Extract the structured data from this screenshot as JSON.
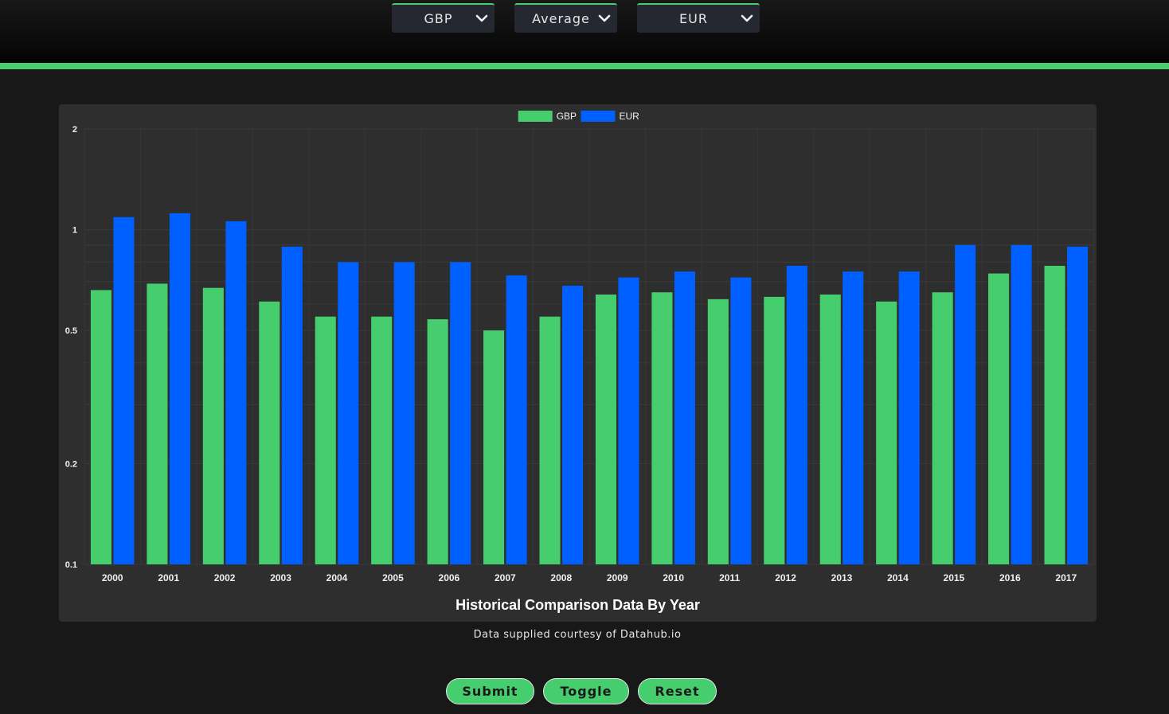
{
  "controls": {
    "base_currency": "GBP",
    "statistic": "Average",
    "target_currency": "EUR"
  },
  "colors": {
    "accent": "#46cd6e",
    "series_gbp": "#46cd6e",
    "series_eur": "#0060ff"
  },
  "icons": {
    "dropdown": "chevron-down-icon"
  },
  "chart_data": {
    "type": "bar",
    "title": "Historical Comparison Data By Year",
    "xlabel": "",
    "ylabel": "",
    "yscale": "log",
    "ylim": [
      0.1,
      2
    ],
    "yticks": [
      2,
      1,
      0.5,
      0.2,
      0.1
    ],
    "ytick_labels": [
      "2",
      "1",
      "0.5",
      "0.2",
      "0.1"
    ],
    "grid": true,
    "legend": "top-center",
    "categories": [
      "2000",
      "2001",
      "2002",
      "2003",
      "2004",
      "2005",
      "2006",
      "2007",
      "2008",
      "2009",
      "2010",
      "2011",
      "2012",
      "2013",
      "2014",
      "2015",
      "2016",
      "2017"
    ],
    "series": [
      {
        "name": "GBP",
        "color": "#46cd6e",
        "values": [
          0.66,
          0.69,
          0.67,
          0.61,
          0.55,
          0.55,
          0.54,
          0.5,
          0.55,
          0.64,
          0.65,
          0.62,
          0.63,
          0.64,
          0.61,
          0.65,
          0.74,
          0.78
        ]
      },
      {
        "name": "EUR",
        "color": "#0060ff",
        "values": [
          1.09,
          1.12,
          1.06,
          0.89,
          0.8,
          0.8,
          0.8,
          0.73,
          0.68,
          0.72,
          0.75,
          0.72,
          0.78,
          0.75,
          0.75,
          0.9,
          0.9,
          0.89
        ]
      }
    ]
  },
  "footer": {
    "credit": "Data supplied courtesy of Datahub.io"
  },
  "buttons": {
    "submit": "Submit",
    "toggle": "Toggle",
    "reset": "Reset"
  }
}
